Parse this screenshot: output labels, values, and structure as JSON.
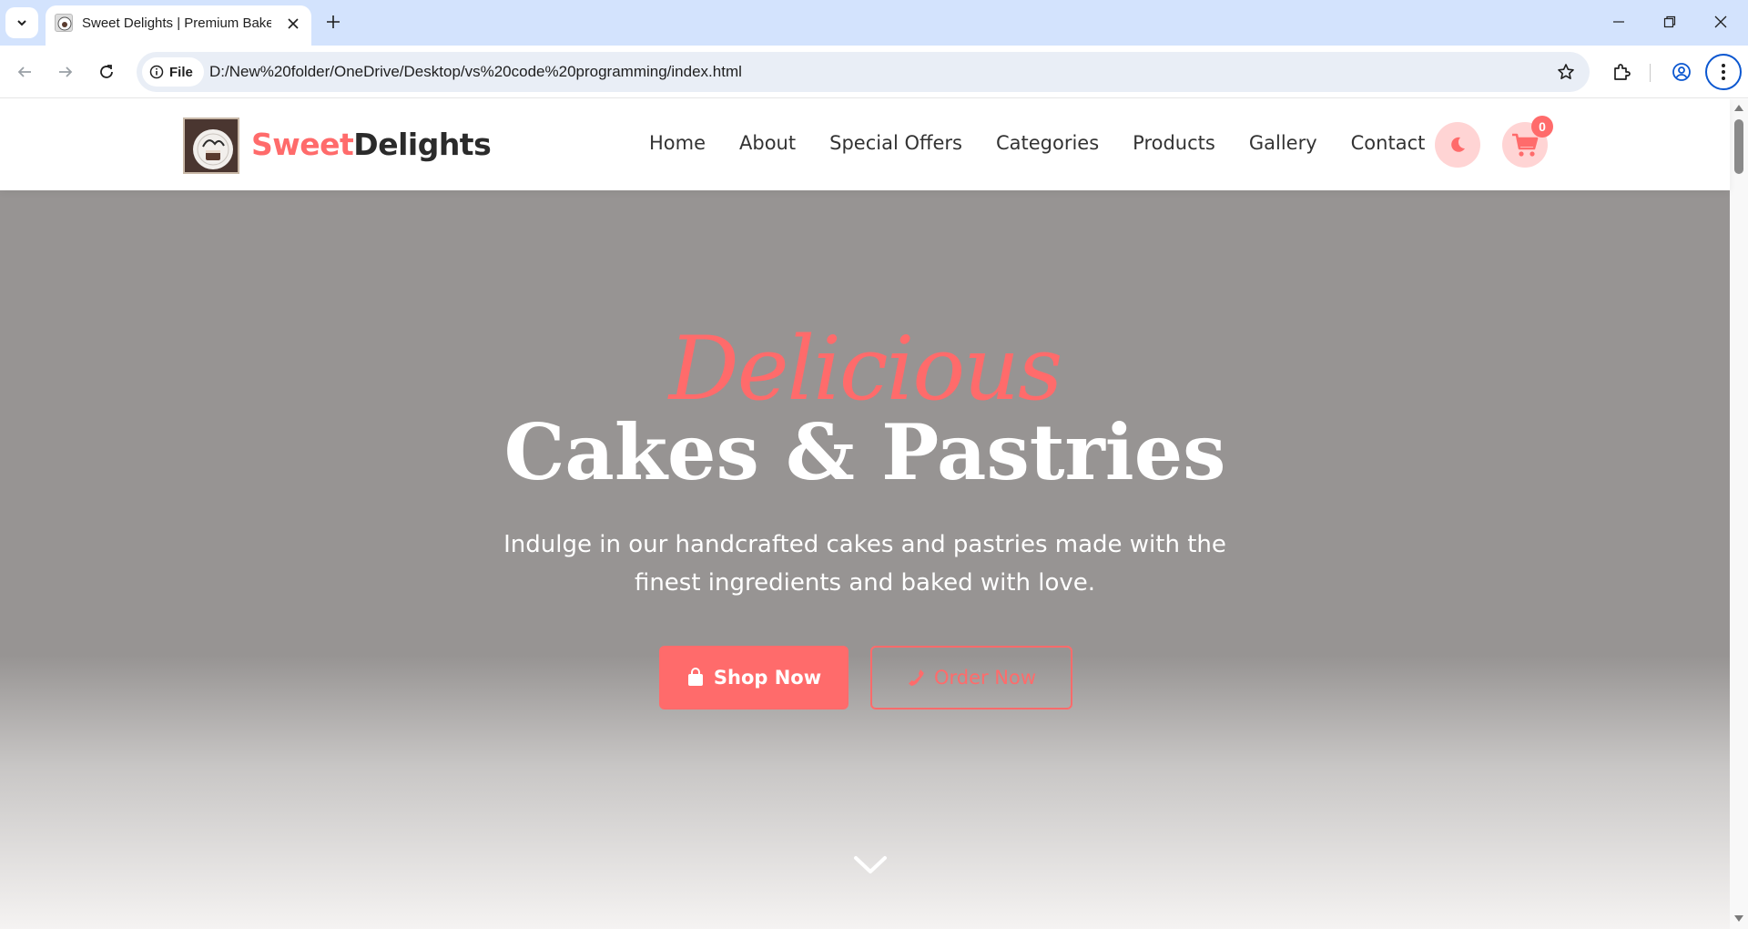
{
  "browser": {
    "tab_title": "Sweet Delights | Premium Bakery",
    "chip_label": "File",
    "url": "D:/New%20folder/OneDrive/Desktop/vs%20code%20programming/index.html"
  },
  "site": {
    "logo_accent": "Sweet",
    "logo_rest": "Delights",
    "nav": [
      "Home",
      "About",
      "Special Offers",
      "Categories",
      "Products",
      "Gallery",
      "Contact"
    ],
    "cart_count": "0"
  },
  "hero": {
    "script": "Delicious",
    "title": "Cakes & Pastries",
    "subtitle": "Indulge in our handcrafted cakes and pastries made with the finest ingredients and baked with love.",
    "shop_label": "Shop Now",
    "order_label": "Order Now"
  },
  "colors": {
    "accent": "#ff6b6b",
    "hero_overlay": "#979493",
    "browser_frame": "#d3e3fd"
  },
  "icons": [
    "tab-list-icon",
    "close-icon",
    "plus-icon",
    "minimize-icon",
    "restore-icon",
    "back-icon",
    "forward-icon",
    "reload-icon",
    "info-icon",
    "star-icon",
    "extensions-icon",
    "profile-icon",
    "more-icon",
    "moon-icon",
    "cart-icon",
    "bag-icon",
    "phone-icon",
    "chevron-down-icon"
  ]
}
